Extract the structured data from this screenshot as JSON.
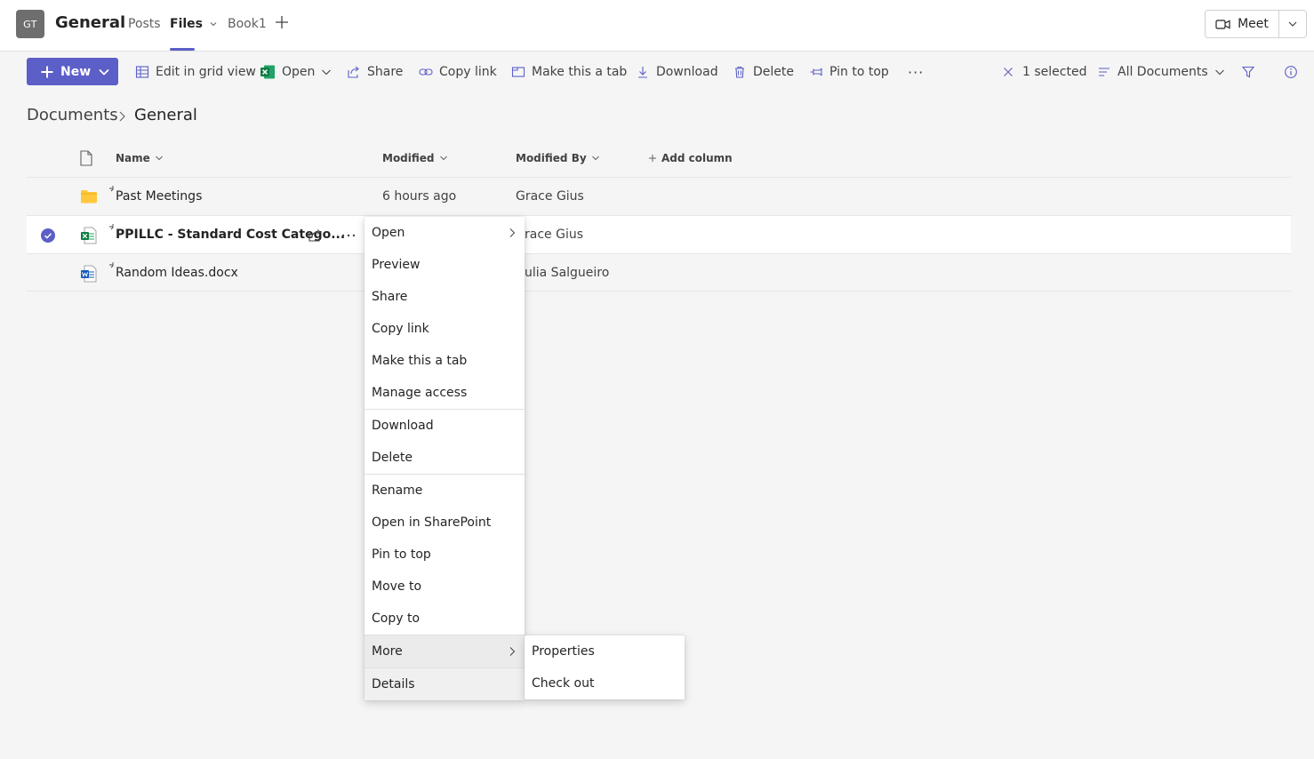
{
  "header": {
    "avatar_initials": "GT",
    "team_title": "General",
    "tabs": [
      {
        "label": "Posts"
      },
      {
        "label": "Files"
      },
      {
        "label": "Book1"
      }
    ],
    "meet_label": "Meet"
  },
  "toolbar": {
    "new_label": "New",
    "edit_grid_label": "Edit in grid view",
    "open_label": "Open",
    "share_label": "Share",
    "copy_link_label": "Copy link",
    "make_tab_label": "Make this a tab",
    "download_label": "Download",
    "delete_label": "Delete",
    "pin_label": "Pin to top",
    "more_label": "···",
    "selected_label": "1 selected",
    "view_label": "All Documents"
  },
  "breadcrumb": {
    "root": "Documents",
    "current": "General"
  },
  "list": {
    "columns": {
      "name": "Name",
      "modified": "Modified",
      "modified_by": "Modified By",
      "add_column": "Add column"
    },
    "rows": [
      {
        "name": "Past Meetings",
        "modified": "6 hours ago",
        "modified_by": "Grace Gius"
      },
      {
        "name": "PPILLC - Standard Cost Catego...",
        "modified": "",
        "modified_by": "race Gius"
      },
      {
        "name": "Random Ideas.docx",
        "modified": "",
        "modified_by": "ulia Salgueiro"
      }
    ]
  },
  "context_menu": {
    "items": [
      {
        "label": "Open"
      },
      {
        "label": "Preview"
      },
      {
        "label": "Share"
      },
      {
        "label": "Copy link"
      },
      {
        "label": "Make this a tab"
      },
      {
        "label": "Manage access"
      },
      {
        "label": "Download"
      },
      {
        "label": "Delete"
      },
      {
        "label": "Rename"
      },
      {
        "label": "Open in SharePoint"
      },
      {
        "label": "Pin to top"
      },
      {
        "label": "Move to"
      },
      {
        "label": "Copy to"
      },
      {
        "label": "More"
      },
      {
        "label": "Details"
      }
    ]
  },
  "submenu": {
    "items": [
      {
        "label": "Properties"
      },
      {
        "label": "Check out"
      }
    ]
  },
  "colors": {
    "accent": "#5b5fc7",
    "folder": "#ffc83d",
    "excel": "#107c41",
    "word": "#185abd"
  }
}
